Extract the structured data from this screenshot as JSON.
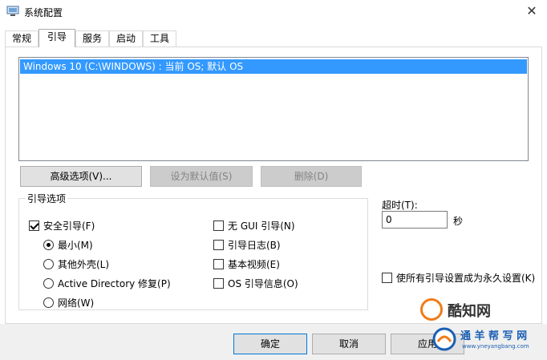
{
  "window": {
    "title": "系统配置",
    "close_glyph": "✕"
  },
  "tabs": [
    {
      "label": "常规"
    },
    {
      "label": "引导",
      "active": true
    },
    {
      "label": "服务"
    },
    {
      "label": "启动"
    },
    {
      "label": "工具"
    }
  ],
  "os_list": {
    "items": [
      "Windows 10 (C:\\WINDOWS) : 当前 OS; 默认 OS"
    ]
  },
  "buttons": {
    "advanced": "高级选项(V)...",
    "set_default": "设为默认值(S)",
    "delete": "删除(D)"
  },
  "boot_options": {
    "group_label": "引导选项",
    "safe_boot": {
      "label": "安全引导(F)",
      "checked": true
    },
    "radios": [
      {
        "label": "最小(M)",
        "checked": true
      },
      {
        "label": "其他外壳(L)",
        "checked": false
      },
      {
        "label": "Active Directory 修复(P)",
        "checked": false
      },
      {
        "label": "网络(W)",
        "checked": false
      }
    ],
    "checkboxes": [
      {
        "label": "无 GUI 引导(N)",
        "checked": false
      },
      {
        "label": "引导日志(B)",
        "checked": false
      },
      {
        "label": "基本视频(E)",
        "checked": false
      },
      {
        "label": "OS 引导信息(O)",
        "checked": false
      }
    ]
  },
  "timeout": {
    "label": "超时(T):",
    "value": "0",
    "unit": "秒"
  },
  "permanent": {
    "label": "使所有引导设置成为永久设置(K)",
    "checked": false
  },
  "dialog_buttons": {
    "ok": "确定",
    "cancel": "取消",
    "apply": "应用"
  },
  "watermark": {
    "brand": "酷知网",
    "site_name": "通 羊 帮 写 网",
    "site_url": "www.yneyangbang.com",
    "brand_color": "#f07c1a",
    "site_color": "#1a5fb4"
  },
  "colors": {
    "selection": "#3399ff",
    "button_face": "#e1e1e1",
    "footer": "#f0f0f0"
  }
}
